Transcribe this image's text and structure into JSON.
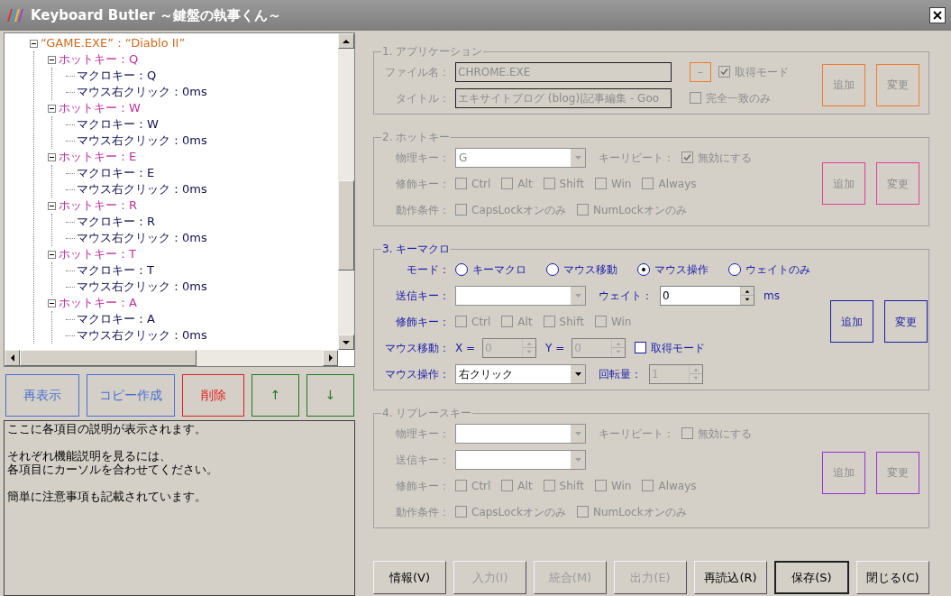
{
  "window": {
    "title": "Keyboard Butler ～鍵盤の執事くん～"
  },
  "tree": [
    {
      "label": "“GAME.EXE”：“Diablo II”",
      "kind": "app",
      "expanded": true,
      "children": [
        {
          "label": "ホットキー：Q",
          "kind": "hotkey",
          "expanded": true,
          "children": [
            {
              "label": "マクロキー：Q",
              "kind": "action"
            },
            {
              "label": "マウス右クリック：0ms",
              "kind": "action"
            }
          ]
        },
        {
          "label": "ホットキー：W",
          "kind": "hotkey",
          "expanded": true,
          "children": [
            {
              "label": "マクロキー：W",
              "kind": "action"
            },
            {
              "label": "マウス右クリック：0ms",
              "kind": "action"
            }
          ]
        },
        {
          "label": "ホットキー：E",
          "kind": "hotkey",
          "expanded": true,
          "children": [
            {
              "label": "マクロキー：E",
              "kind": "action"
            },
            {
              "label": "マウス右クリック：0ms",
              "kind": "action"
            }
          ]
        },
        {
          "label": "ホットキー：R",
          "kind": "hotkey",
          "expanded": true,
          "children": [
            {
              "label": "マクロキー：R",
              "kind": "action"
            },
            {
              "label": "マウス右クリック：0ms",
              "kind": "action"
            }
          ]
        },
        {
          "label": "ホットキー：T",
          "kind": "hotkey",
          "expanded": true,
          "children": [
            {
              "label": "マクロキー：T",
              "kind": "action"
            },
            {
              "label": "マウス右クリック：0ms",
              "kind": "action"
            }
          ]
        },
        {
          "label": "ホットキー：A",
          "kind": "hotkey",
          "expanded": true,
          "children": [
            {
              "label": "マクロキー：A",
              "kind": "action"
            },
            {
              "label": "マウス右クリック：0ms",
              "kind": "action"
            }
          ]
        }
      ]
    }
  ],
  "tree_buttons": [
    {
      "label": "再表示",
      "color": "#4a6fd0"
    },
    {
      "label": "コピー作成",
      "color": "#4a6fd0"
    },
    {
      "label": "削除",
      "color": "#e02020"
    },
    {
      "label": "↑",
      "color": "#207a20"
    },
    {
      "label": "↓",
      "color": "#207a20"
    }
  ],
  "description": [
    [
      "ここに各項目の説明が表示されます。"
    ],
    [
      "それぞれ機能説明を見るには、",
      "各項目にカーソルを合わせてください。"
    ],
    [
      "簡単に注意事項も記載されています。"
    ]
  ],
  "sections": [
    {
      "title": "1. アプリケーション",
      "color": "#f07a30",
      "disabled": true,
      "buttons": [
        "追加",
        "変更"
      ],
      "rows": [
        {
          "label": "ファイル名：",
          "controls": [
            {
              "kind": "field",
              "value": "CHROME.EXE"
            },
            {
              "kind": "mini_button",
              "text": "－"
            },
            {
              "kind": "check",
              "text": "取得モード",
              "checked": true
            }
          ]
        },
        {
          "label": "タイトル：",
          "controls": [
            {
              "kind": "field",
              "value": "エキサイトブログ (blog)|記事編集 - Goo"
            },
            {
              "kind": "check",
              "text": "完全一致のみ",
              "checked": false
            }
          ]
        }
      ]
    },
    {
      "title": "2. ホットキー",
      "color": "#e0409a",
      "disabled": true,
      "buttons": [
        "追加",
        "変更"
      ],
      "rows": [
        {
          "label": "物理キー：",
          "controls": [
            {
              "kind": "combo",
              "value": "G"
            },
            {
              "kind": "text",
              "text": "キーリピート："
            },
            {
              "kind": "check",
              "text": "無効にする",
              "checked": true
            }
          ]
        },
        {
          "label": "修飾キー：",
          "controls": [
            {
              "kind": "check",
              "text": "Ctrl",
              "checked": false
            },
            {
              "kind": "check",
              "text": "Alt",
              "checked": false
            },
            {
              "kind": "check",
              "text": "Shift",
              "checked": false
            },
            {
              "kind": "check",
              "text": "Win",
              "checked": false
            },
            {
              "kind": "check",
              "text": "Always",
              "checked": false
            }
          ]
        },
        {
          "label": "動作条件：",
          "controls": [
            {
              "kind": "check",
              "text": "CapsLockオンのみ",
              "checked": false
            },
            {
              "kind": "check",
              "text": "NumLockオンのみ",
              "checked": false
            }
          ]
        }
      ]
    },
    {
      "title": "3. キーマクロ",
      "color": "#1c1ca8",
      "disabled": false,
      "buttons": [
        "追加",
        "変更"
      ],
      "rows": [
        {
          "label": "モード：",
          "controls": [
            {
              "kind": "radio",
              "text": "キーマクロ",
              "selected": false
            },
            {
              "kind": "radio",
              "text": "マウス移動",
              "selected": false
            },
            {
              "kind": "radio",
              "text": "マウス操作",
              "selected": true
            },
            {
              "kind": "radio",
              "text": "ウェイトのみ",
              "selected": false
            }
          ]
        },
        {
          "label": "送信キー：",
          "controls": [
            {
              "kind": "combo",
              "disabled": true
            },
            {
              "kind": "text",
              "text": "ウェイト："
            },
            {
              "kind": "spin",
              "value": "0",
              "disabled": false
            },
            {
              "kind": "text",
              "text": "ms"
            }
          ]
        },
        {
          "label": "修飾キー：",
          "controls": [
            {
              "kind": "check",
              "text": "Ctrl",
              "checked": false,
              "disabled": true
            },
            {
              "kind": "check",
              "text": "Alt",
              "checked": false,
              "disabled": true
            },
            {
              "kind": "check",
              "text": "Shift",
              "checked": false,
              "disabled": true
            },
            {
              "kind": "check",
              "text": "Win",
              "checked": false,
              "disabled": true
            }
          ]
        },
        {
          "label": "マウス移動：",
          "controls": [
            {
              "kind": "text",
              "text": "X ="
            },
            {
              "kind": "mini_spin",
              "value": "0",
              "disabled": true
            },
            {
              "kind": "text",
              "text": "Y ="
            },
            {
              "kind": "mini_spin",
              "value": "0",
              "disabled": true
            },
            {
              "kind": "check",
              "text": "取得モード",
              "checked": false,
              "disabled": false
            }
          ]
        },
        {
          "label": "マウス操作：",
          "controls": [
            {
              "kind": "combo",
              "value": "右クリック",
              "disabled": false
            },
            {
              "kind": "text",
              "text": "回転量："
            },
            {
              "kind": "mini_spin",
              "value": "1",
              "disabled": true
            }
          ]
        }
      ]
    },
    {
      "title": "4. リプレースキー",
      "color": "#9a30d0",
      "disabled": true,
      "buttons": [
        "追加",
        "変更"
      ],
      "rows": [
        {
          "label": "物理キー：",
          "controls": [
            {
              "kind": "combo"
            },
            {
              "kind": "text",
              "text": "キーリピート："
            },
            {
              "kind": "check",
              "text": "無効にする",
              "checked": false
            }
          ]
        },
        {
          "label": "送信キー：",
          "controls": [
            {
              "kind": "combo"
            }
          ]
        },
        {
          "label": "修飾キー：",
          "controls": [
            {
              "kind": "check",
              "text": "Ctrl",
              "checked": false
            },
            {
              "kind": "check",
              "text": "Alt",
              "checked": false
            },
            {
              "kind": "check",
              "text": "Shift",
              "checked": false
            },
            {
              "kind": "check",
              "text": "Win",
              "checked": false
            },
            {
              "kind": "check",
              "text": "Always",
              "checked": false
            }
          ]
        },
        {
          "label": "動作条件：",
          "controls": [
            {
              "kind": "check",
              "text": "CapsLockオンのみ",
              "checked": false
            },
            {
              "kind": "check",
              "text": "NumLockオンのみ",
              "checked": false
            }
          ]
        }
      ]
    }
  ],
  "footer_buttons": [
    {
      "label": "情報(V)",
      "disabled": false,
      "default": false
    },
    {
      "label": "入力(I)",
      "disabled": true,
      "default": false
    },
    {
      "label": "統合(M)",
      "disabled": true,
      "default": false
    },
    {
      "label": "出力(E)",
      "disabled": true,
      "default": false
    },
    {
      "label": "再読込(R)",
      "disabled": false,
      "default": false
    },
    {
      "label": "保存(S)",
      "disabled": false,
      "default": true
    },
    {
      "label": "閉じる(C)",
      "disabled": false,
      "default": false
    }
  ]
}
